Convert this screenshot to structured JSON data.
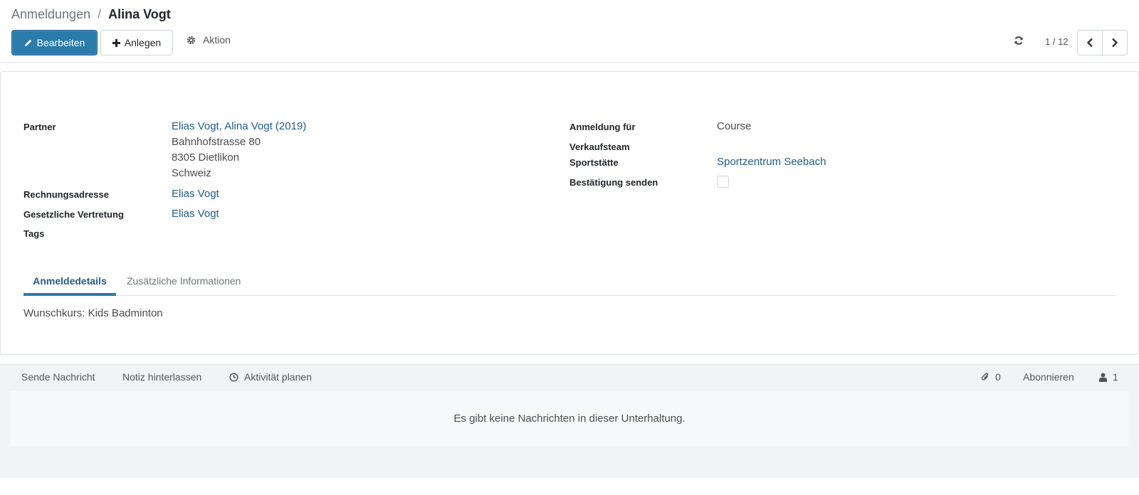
{
  "breadcrumb": {
    "parent": "Anmeldungen",
    "separator": "/",
    "current": "Alina Vogt"
  },
  "toolbar": {
    "edit_label": "Bearbeiten",
    "create_label": "Anlegen",
    "action_label": "Aktion"
  },
  "pager": {
    "value": "1 / 12"
  },
  "form": {
    "partner": {
      "label": "Partner",
      "name": "Elias Vogt, Alina Vogt (2019)",
      "street": "Bahnhofstrasse 80",
      "city": "8305 Dietlikon",
      "country": "Schweiz"
    },
    "invoice_address": {
      "label": "Rechnungsadresse",
      "value": "Elias Vogt"
    },
    "legal_rep": {
      "label": "Gesetzliche Vertretung",
      "value": "Elias Vogt"
    },
    "tags": {
      "label": "Tags",
      "value": ""
    },
    "registration_for": {
      "label": "Anmeldung für",
      "value": "Course"
    },
    "sales_team": {
      "label": "Verkaufsteam",
      "value": ""
    },
    "venue": {
      "label": "Sportstätte",
      "value": "Sportzentrum Seebach"
    },
    "send_confirmation": {
      "label": "Bestätigung senden",
      "checked": false
    }
  },
  "tabs": [
    {
      "label": "Anmeldedetails",
      "active": true
    },
    {
      "label": "Zusätzliche Informationen",
      "active": false
    }
  ],
  "tab_content": {
    "text": "Wunschkurs: Kids Badminton"
  },
  "chatter": {
    "send_message": "Sende Nachricht",
    "log_note": "Notiz hinterlassen",
    "schedule_activity": "Aktivität planen",
    "attachments_count": "0",
    "follow_label": "Abonnieren",
    "followers_count": "1",
    "empty_message": "Es gibt keine Nachrichten in dieser Unterhaltung."
  },
  "colors": {
    "primary": "#2b7bab",
    "link": "#1f5d8a",
    "chatter_bg": "#f1f3f5"
  },
  "icons": {
    "edit": "pencil-icon",
    "create": "plus-icon",
    "action": "gear-icon",
    "reload": "refresh-icon",
    "prev": "chevron-left-icon",
    "next": "chevron-right-icon",
    "activity": "clock-icon",
    "attachment": "paperclip-icon",
    "followers": "user-icon"
  }
}
